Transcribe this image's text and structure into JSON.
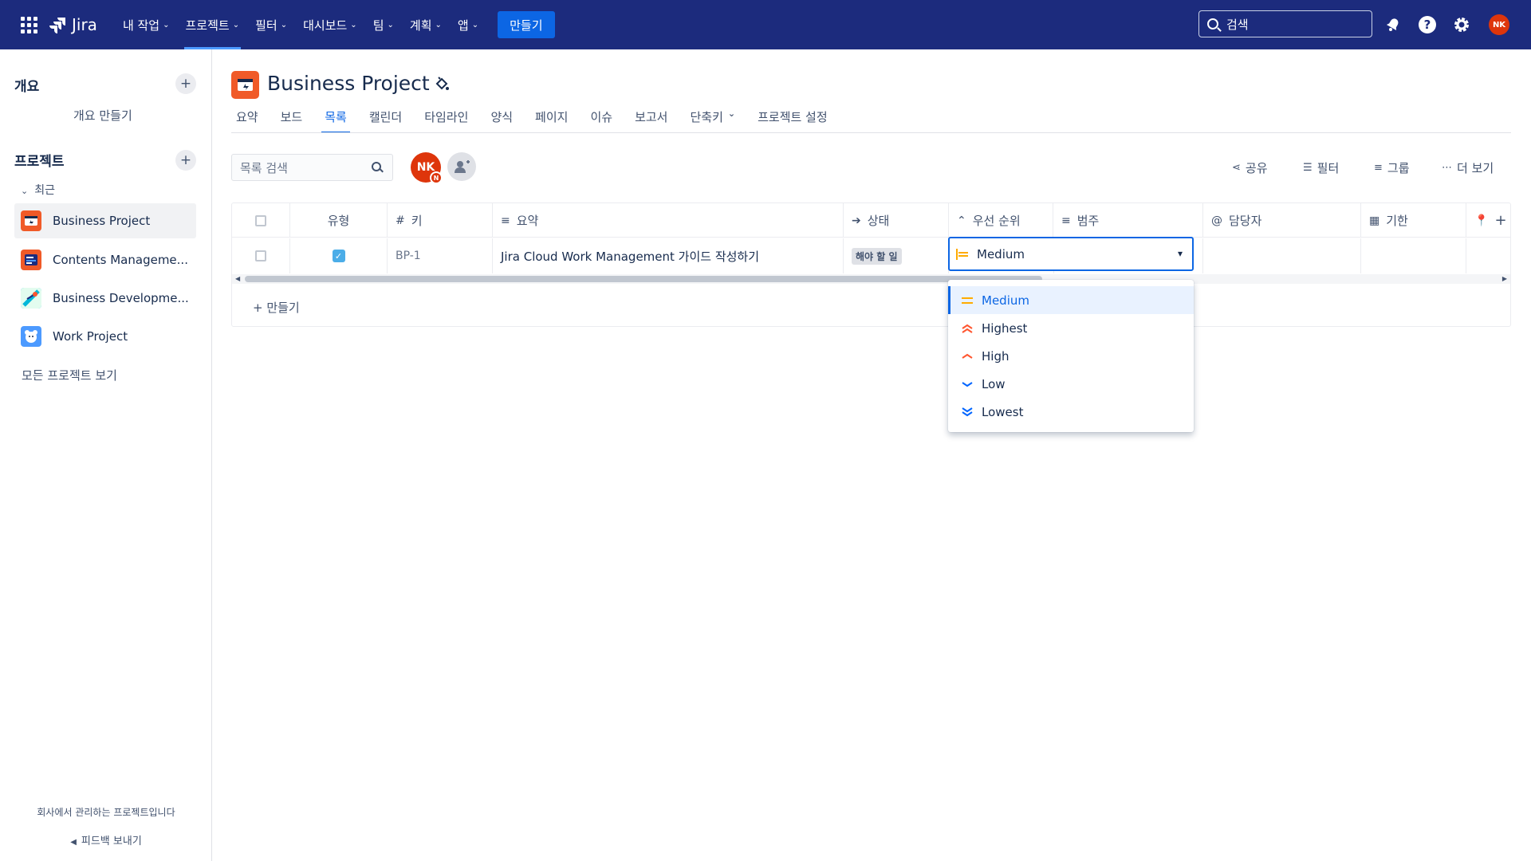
{
  "topnav": {
    "product": "Jira",
    "items": [
      "내 작업",
      "프로젝트",
      "필터",
      "대시보드",
      "팀",
      "계획",
      "앱"
    ],
    "active_index": 1,
    "create_label": "만들기",
    "search_placeholder": "검색",
    "avatar_initials": "NK"
  },
  "sidebar": {
    "overview_title": "개요",
    "overview_create": "개요 만들기",
    "projects_title": "프로젝트",
    "recent_label": "최근",
    "projects": [
      {
        "name": "Business Project",
        "icon": "business-project-icon",
        "color": "#f05a28"
      },
      {
        "name": "Contents Manageme...",
        "icon": "contents-management-icon",
        "color": "#f05a28"
      },
      {
        "name": "Business Developme...",
        "icon": "business-development-icon",
        "color": "#00b8d9"
      },
      {
        "name": "Work Project",
        "icon": "work-project-icon",
        "color": "#4c9aff"
      }
    ],
    "all_projects": "모든 프로젝트 보기",
    "footer_note": "회사에서 관리하는 프로젝트입니다",
    "feedback": "피드백 보내기"
  },
  "project": {
    "title": "Business Project",
    "tabs": [
      "요약",
      "보드",
      "목록",
      "캘린더",
      "타임라인",
      "양식",
      "페이지",
      "이슈",
      "보고서",
      "단축키",
      "프로젝트 설정"
    ],
    "active_tab": 2
  },
  "toolbar": {
    "search_placeholder": "목록 검색",
    "avatar_initials": "NK",
    "avatar_sub": "N",
    "share": "공유",
    "filter": "필터",
    "group": "그룹",
    "more": "더 보기"
  },
  "table": {
    "columns": {
      "type": "유형",
      "key": "키",
      "summary": "요약",
      "status": "상태",
      "priority": "우선 순위",
      "category": "범주",
      "assignee": "담당자",
      "due": "기한"
    },
    "rows": [
      {
        "key": "BP-1",
        "summary": "Jira Cloud Work Management 가이드 작성하기",
        "status": "해야 할 일",
        "priority": "Medium"
      }
    ],
    "create_label": "+ 만들기"
  },
  "priority_menu": {
    "current": "Medium",
    "options": [
      {
        "label": "Medium",
        "icon": "priority-medium-icon",
        "color": "#ffab00"
      },
      {
        "label": "Highest",
        "icon": "priority-highest-icon",
        "color": "#ff5630"
      },
      {
        "label": "High",
        "icon": "priority-high-icon",
        "color": "#ff5630"
      },
      {
        "label": "Low",
        "icon": "priority-low-icon",
        "color": "#0065ff"
      },
      {
        "label": "Lowest",
        "icon": "priority-lowest-icon",
        "color": "#0065ff"
      }
    ],
    "selected_index": 0
  }
}
